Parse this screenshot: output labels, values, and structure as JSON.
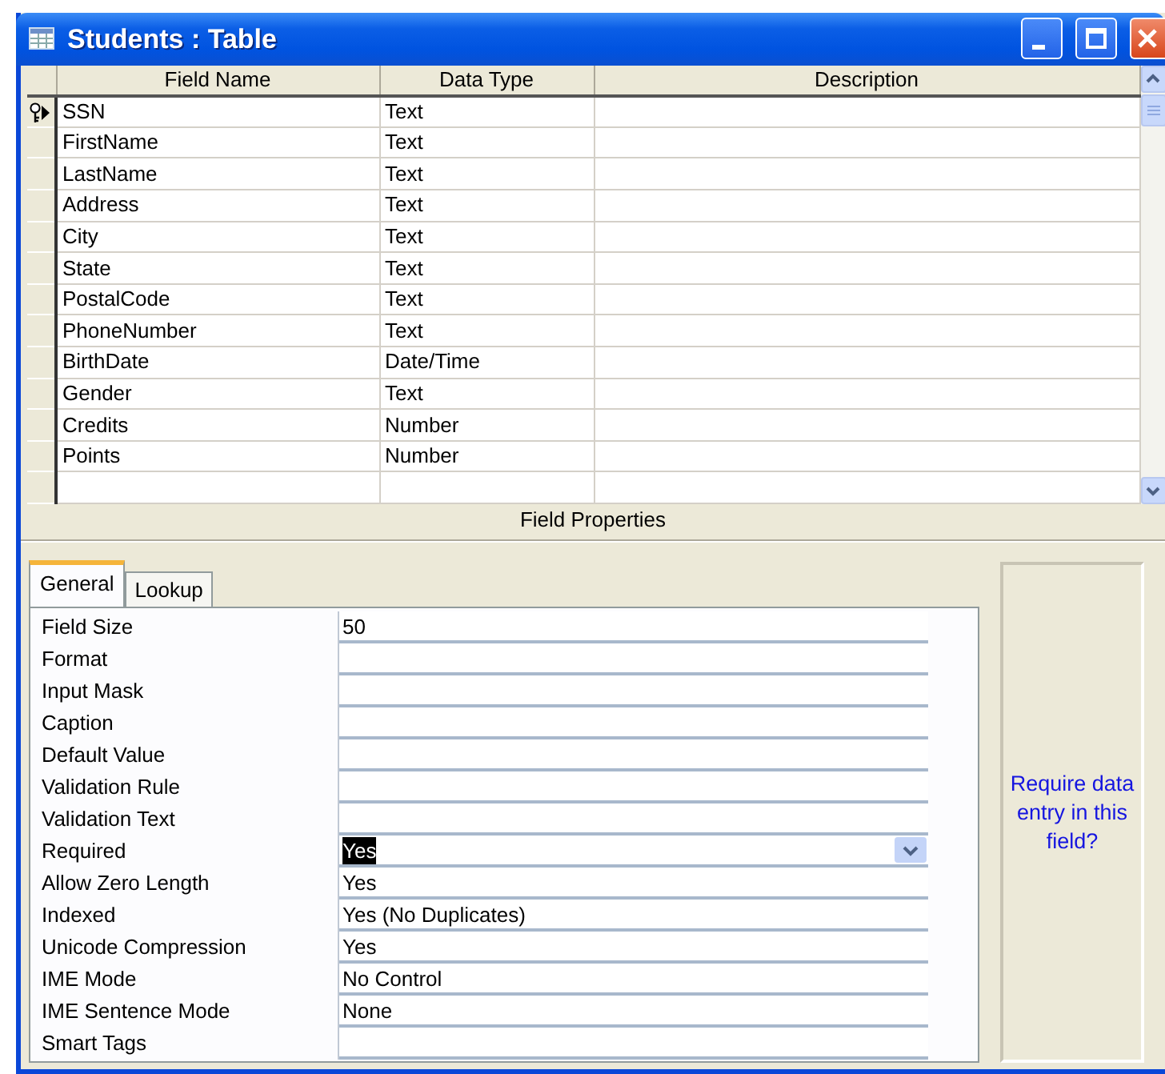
{
  "window": {
    "title": "Students : Table"
  },
  "grid": {
    "columns": [
      "Field Name",
      "Data Type",
      "Description"
    ],
    "rows": [
      {
        "field_name": "SSN",
        "data_type": "Text",
        "primary_key": true,
        "current": true
      },
      {
        "field_name": "FirstName",
        "data_type": "Text",
        "primary_key": false,
        "current": false
      },
      {
        "field_name": "LastName",
        "data_type": "Text",
        "primary_key": false,
        "current": false
      },
      {
        "field_name": "Address",
        "data_type": "Text",
        "primary_key": false,
        "current": false
      },
      {
        "field_name": "City",
        "data_type": "Text",
        "primary_key": false,
        "current": false
      },
      {
        "field_name": "State",
        "data_type": "Text",
        "primary_key": false,
        "current": false
      },
      {
        "field_name": "PostalCode",
        "data_type": "Text",
        "primary_key": false,
        "current": false
      },
      {
        "field_name": "PhoneNumber",
        "data_type": "Text",
        "primary_key": false,
        "current": false
      },
      {
        "field_name": "BirthDate",
        "data_type": "Date/Time",
        "primary_key": false,
        "current": false
      },
      {
        "field_name": "Gender",
        "data_type": "Text",
        "primary_key": false,
        "current": false
      },
      {
        "field_name": "Credits",
        "data_type": "Number",
        "primary_key": false,
        "current": false
      },
      {
        "field_name": "Points",
        "data_type": "Number",
        "primary_key": false,
        "current": false
      }
    ]
  },
  "field_properties": {
    "heading": "Field Properties",
    "tabs": [
      {
        "label": "General",
        "selected": true
      },
      {
        "label": "Lookup",
        "selected": false
      }
    ],
    "properties": [
      {
        "label": "Field Size",
        "value": "50",
        "selected": false
      },
      {
        "label": "Format",
        "selected": false
      },
      {
        "label": "Input Mask",
        "selected": false
      },
      {
        "label": "Caption",
        "selected": false
      },
      {
        "label": "Default Value",
        "selected": false
      },
      {
        "label": "Validation Rule",
        "selected": false
      },
      {
        "label": "Validation Text",
        "selected": false
      },
      {
        "label": "Required",
        "value": "Yes",
        "selected": true
      },
      {
        "label": "Allow Zero Length",
        "value": "Yes",
        "selected": false
      },
      {
        "label": "Indexed",
        "value": "Yes (No Duplicates)",
        "selected": false
      },
      {
        "label": "Unicode Compression",
        "value": "Yes",
        "selected": false
      },
      {
        "label": "IME Mode",
        "value": "No Control",
        "selected": false
      },
      {
        "label": "IME Sentence Mode",
        "value": "None",
        "selected": false
      },
      {
        "label": "Smart Tags",
        "selected": false
      }
    ],
    "help_text": "Require data entry in this field?"
  }
}
